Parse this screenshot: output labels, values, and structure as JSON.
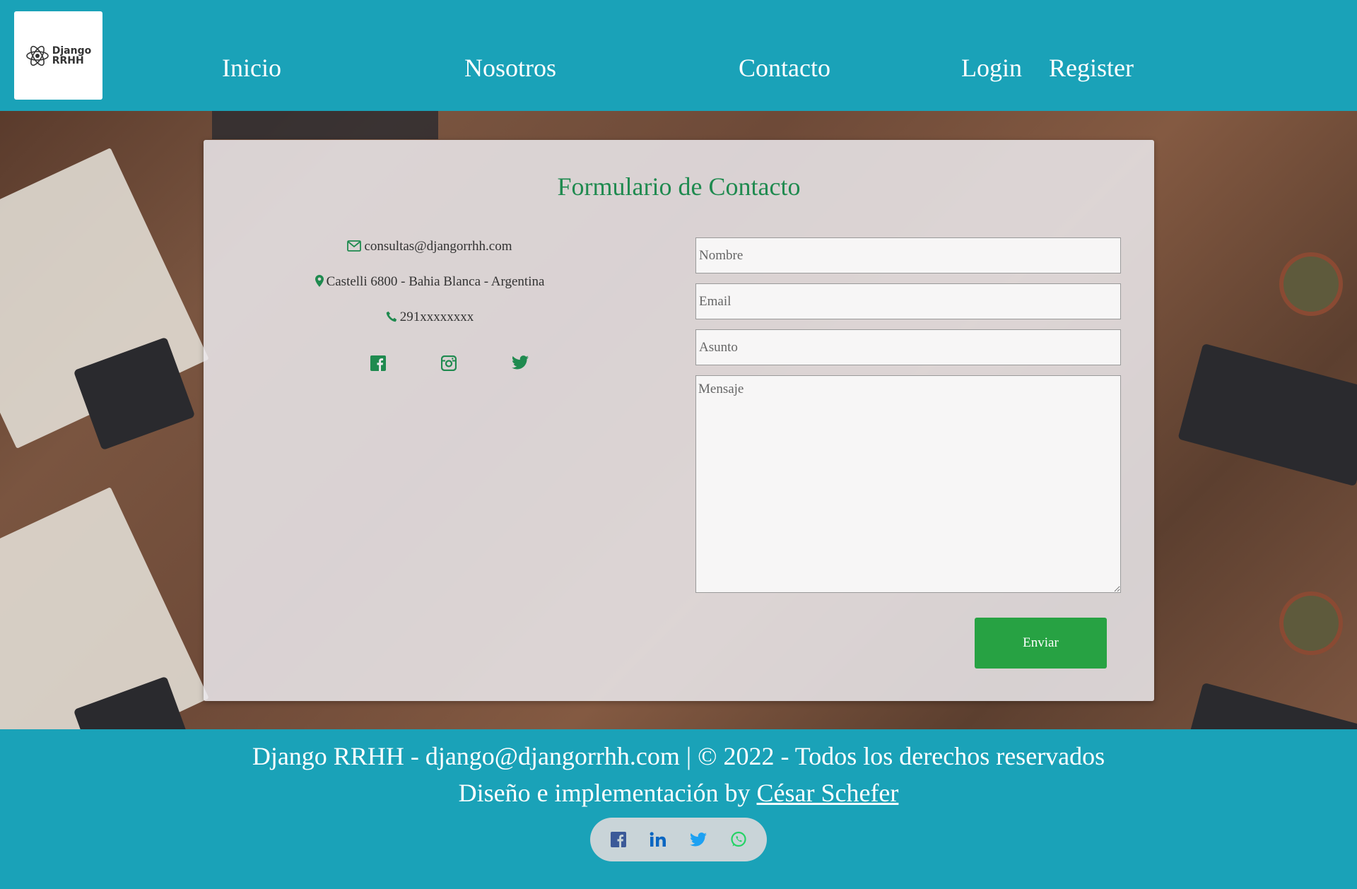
{
  "header": {
    "logo_text_line1": "Django",
    "logo_text_line2": "RRHH",
    "nav": {
      "inicio": "Inicio",
      "nosotros": "Nosotros",
      "contacto": "Contacto",
      "login": "Login",
      "register": "Register"
    }
  },
  "contact": {
    "title": "Formulario de Contacto",
    "email": "consultas@djangorrhh.com",
    "address": "Castelli 6800 - Bahia Blanca - Argentina",
    "phone": "291xxxxxxxx",
    "social_icons": [
      "facebook-icon",
      "instagram-icon",
      "twitter-icon"
    ],
    "form": {
      "nombre_placeholder": "Nombre",
      "email_placeholder": "Email",
      "asunto_placeholder": "Asunto",
      "mensaje_placeholder": "Mensaje",
      "submit_label": "Enviar"
    }
  },
  "footer": {
    "line1": "Django RRHH - django@djangorrhh.com | © 2022 - Todos los derechos reservados",
    "line2_prefix": "Diseño e implementación by ",
    "author_link": "César Schefer",
    "social_icons": [
      "facebook-icon",
      "linkedin-icon",
      "twitter-icon",
      "whatsapp-icon"
    ]
  },
  "colors": {
    "brand": "#1aa2b8",
    "accent_green": "#27a243",
    "title_green": "#1f8a4f"
  }
}
